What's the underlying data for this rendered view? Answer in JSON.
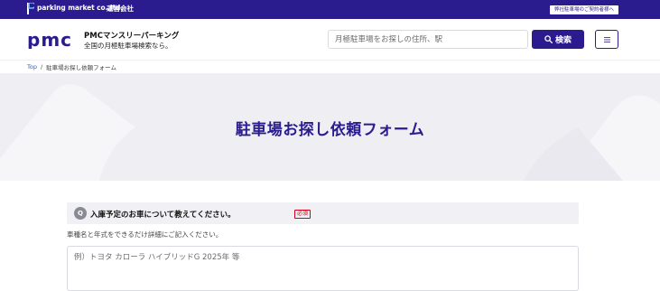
{
  "topbar": {
    "company": "parking market co.,ltd.",
    "operator": "運営会社",
    "contract_link": "弊社駐車場のご契約者様へ"
  },
  "header": {
    "brand_name": "PMCマンスリーパーキング",
    "brand_tagline": "全国の月極駐車場検索なら。",
    "search_placeholder": "月極駐車場をお探しの住所、駅",
    "search_button": "検索"
  },
  "breadcrumb": {
    "top": "Top",
    "separator": "/",
    "current": "駐車場お探し依頼フォーム"
  },
  "hero": {
    "title": "駐車場お探し依頼フォーム"
  },
  "form": {
    "question_badge": "Q",
    "question_text": "入庫予定のお車について教えてください。",
    "required_label": "必須",
    "hint": "車種名と年式をできるだけ詳細にご記入ください。",
    "car_placeholder": "例）トヨタ カローラ ハイブリッドG 2025年 等"
  },
  "colors": {
    "brand": "#2a1b8f",
    "required": "#d0021b",
    "link": "#2a5cc9"
  }
}
